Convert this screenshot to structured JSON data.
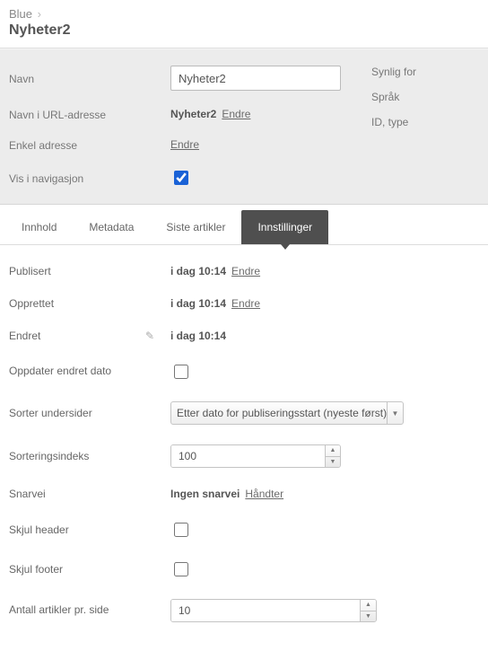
{
  "breadcrumb": {
    "parent": "Blue"
  },
  "page_title": "Nyheter2",
  "header": {
    "name_label": "Navn",
    "name_value": "Nyheter2",
    "url_label": "Navn i URL-adresse",
    "url_value": "Nyheter2",
    "url_change": "Endre",
    "simple_addr_label": "Enkel adresse",
    "simple_addr_link": "Endre",
    "show_nav_label": "Vis i navigasjon",
    "side": {
      "visible_for": "Synlig for",
      "language": "Språk",
      "id_type": "ID, type"
    }
  },
  "tabs": {
    "content": "Innhold",
    "metadata": "Metadata",
    "recent": "Siste artikler",
    "settings": "Innstillinger"
  },
  "settings": {
    "published_label": "Publisert",
    "published_value": "i dag 10:14",
    "published_change": "Endre",
    "created_label": "Opprettet",
    "created_value": "i dag 10:14",
    "created_change": "Endre",
    "modified_label": "Endret",
    "modified_value": "i dag 10:14",
    "update_date_label": "Oppdater endret dato",
    "sort_sub_label": "Sorter undersider",
    "sort_sub_value": "Etter dato for publiseringsstart (nyeste først)",
    "sort_index_label": "Sorteringsindeks",
    "sort_index_value": "100",
    "shortcut_label": "Snarvei",
    "shortcut_value": "Ingen snarvei",
    "shortcut_manage": "Håndter",
    "hide_header_label": "Skjul header",
    "hide_footer_label": "Skjul footer",
    "per_page_label": "Antall artikler pr. side",
    "per_page_value": "10"
  }
}
